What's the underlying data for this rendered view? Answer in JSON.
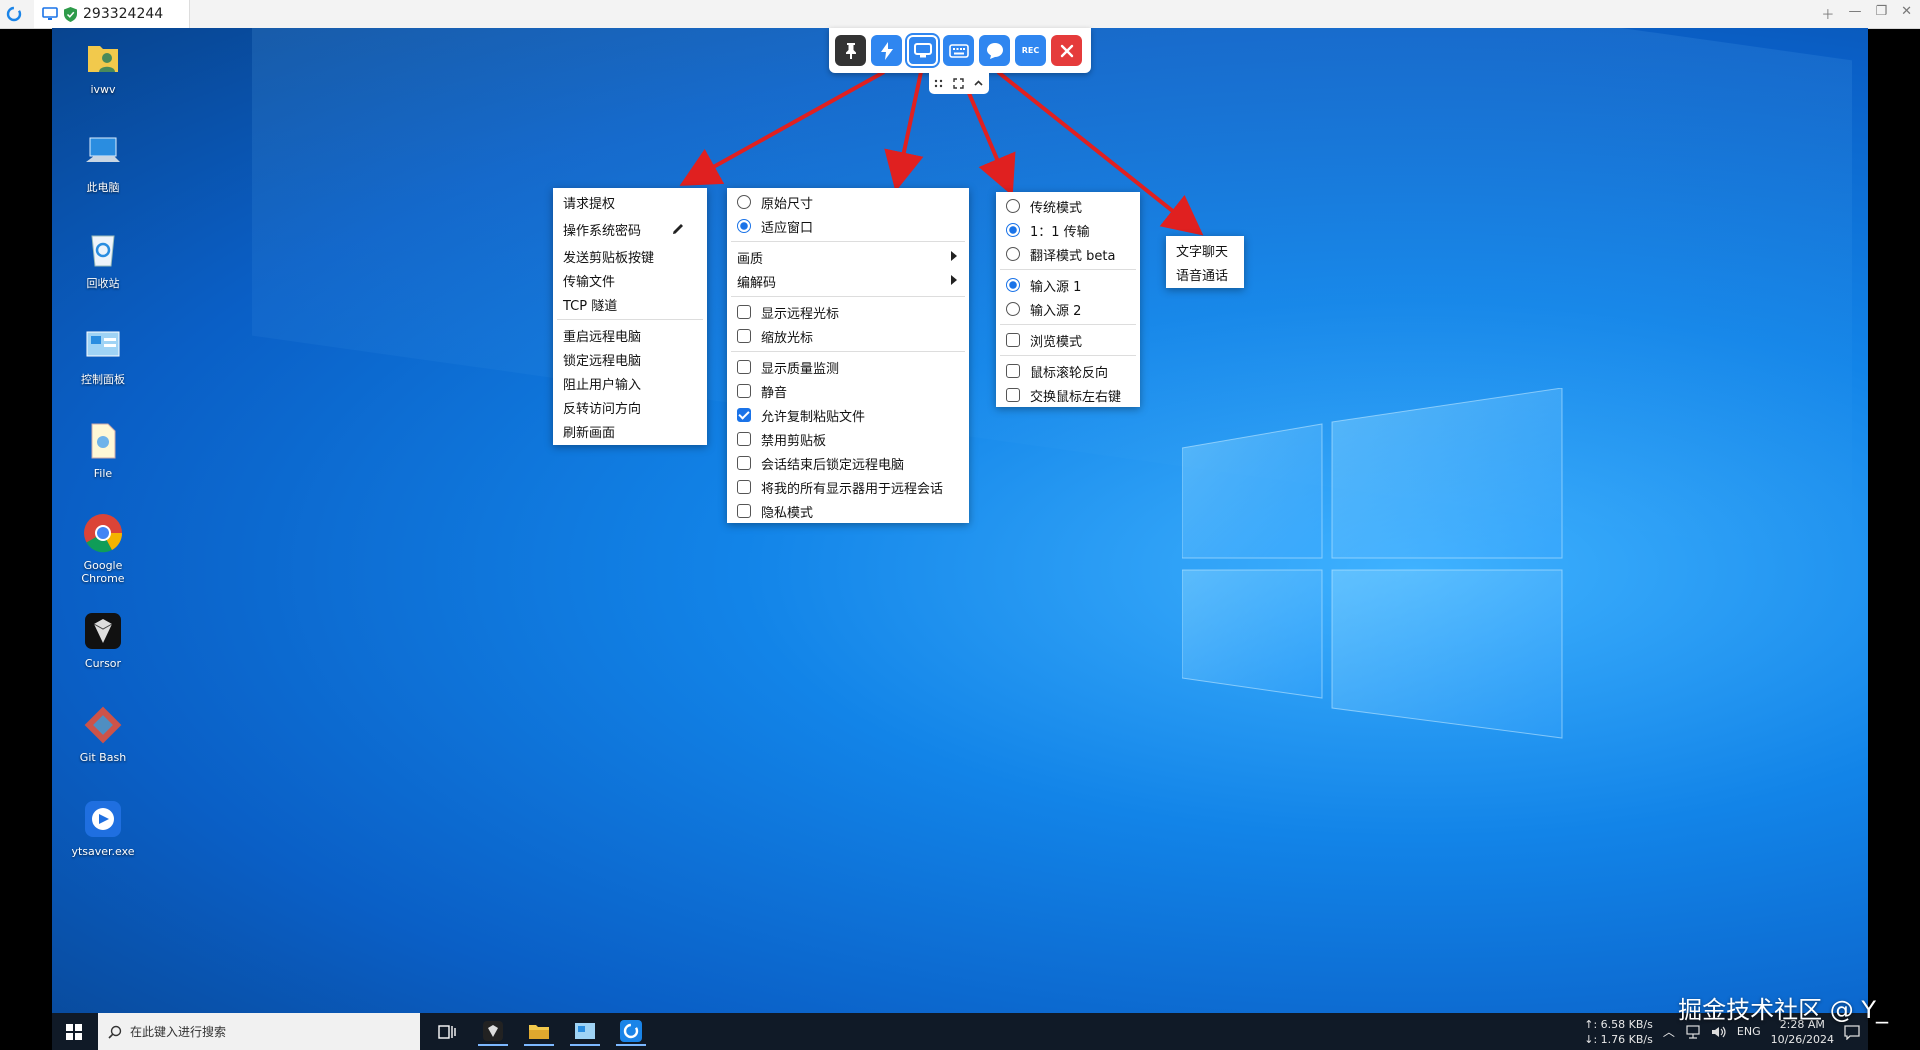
{
  "app": {
    "tab_id": "293324244"
  },
  "desktop_icons": [
    {
      "label": "ivwv",
      "icon": "folder-user-icon"
    },
    {
      "label": "此电脑",
      "icon": "computer-icon"
    },
    {
      "label": "回收站",
      "icon": "recycle-bin-icon"
    },
    {
      "label": "控制面板",
      "icon": "control-panel-icon"
    },
    {
      "label": "File",
      "icon": "file-icon"
    },
    {
      "label": "Google Chrome",
      "icon": "chrome-icon"
    },
    {
      "label": "Cursor",
      "icon": "cursor-app-icon"
    },
    {
      "label": "Git Bash",
      "icon": "git-bash-icon"
    },
    {
      "label": "ytsaver.exe",
      "icon": "ytsaver-icon"
    }
  ],
  "toolbar": {
    "buttons": [
      "pin-icon",
      "lightning-icon",
      "monitor-icon",
      "keyboard-icon",
      "chat-icon",
      "rec-icon",
      "close-icon"
    ],
    "rec_label": "REC"
  },
  "menu_actions": {
    "items": [
      "请求提权",
      "操作系统密码",
      "发送剪贴板按键",
      "传输文件",
      "TCP 隧道",
      "重启远程电脑",
      "锁定远程电脑",
      "阻止用户输入",
      "反转访问方向",
      "刷新画面"
    ]
  },
  "menu_display": {
    "size_options": [
      {
        "label": "原始尺寸",
        "selected": false
      },
      {
        "label": "适应窗口",
        "selected": true
      }
    ],
    "submenus": [
      "画质",
      "编解码"
    ],
    "cursor_options": [
      {
        "label": "显示远程光标",
        "checked": false
      },
      {
        "label": "缩放光标",
        "checked": false
      }
    ],
    "other_options": [
      {
        "label": "显示质量监测",
        "checked": false
      },
      {
        "label": "静音",
        "checked": false
      },
      {
        "label": "允许复制粘贴文件",
        "checked": true
      },
      {
        "label": "禁用剪贴板",
        "checked": false
      },
      {
        "label": "会话结束后锁定远程电脑",
        "checked": false
      },
      {
        "label": "将我的所有显示器用于远程会话",
        "checked": false
      },
      {
        "label": "隐私模式",
        "checked": false
      }
    ]
  },
  "menu_keyboard": {
    "modes": [
      {
        "label": "传统模式",
        "selected": false
      },
      {
        "label": "1：1 传输",
        "selected": true
      },
      {
        "label": "翻译模式 beta",
        "selected": false
      }
    ],
    "input_sources": [
      {
        "label": "输入源 1",
        "selected": true
      },
      {
        "label": "输入源 2",
        "selected": false
      }
    ],
    "browse": {
      "label": "浏览模式",
      "checked": false
    },
    "mouse_options": [
      {
        "label": "鼠标滚轮反向",
        "checked": false
      },
      {
        "label": "交换鼠标左右键",
        "checked": false
      }
    ]
  },
  "menu_chat": {
    "items": [
      "文字聊天",
      "语音通话"
    ]
  },
  "taskbar": {
    "search_placeholder": "在此键入进行搜索",
    "upload_speed": "↑: 6.58 KB/s",
    "download_speed": "↓: 1.76 KB/s",
    "language": "ENG",
    "time": "2:28 AM",
    "date": "10/26/2024"
  },
  "watermark": "掘金技术社区 @ Y_",
  "colors": {
    "accent": "#2f86f0",
    "close": "#e53b3b",
    "arrow": "#e02020",
    "taskbar": "#101a27"
  }
}
